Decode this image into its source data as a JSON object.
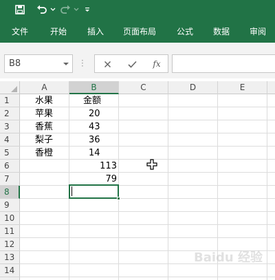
{
  "app": {
    "accent": "#217346"
  },
  "quick_access": {
    "save_icon": "save-icon",
    "undo_icon": "undo-icon",
    "redo_icon": "redo-icon",
    "customize_icon": "customize-quick-access-icon"
  },
  "ribbon": {
    "tabs": [
      "文件",
      "开始",
      "插入",
      "页面布局",
      "公式",
      "数据",
      "审阅"
    ]
  },
  "formula_bar": {
    "name_box": "B8",
    "cancel_icon": "cancel-icon",
    "enter_icon": "check-icon",
    "fx_label": "fx",
    "formula": ""
  },
  "sheet": {
    "columns": [
      "A",
      "B",
      "C",
      "D",
      "E"
    ],
    "rows": [
      "1",
      "2",
      "3",
      "4",
      "5",
      "6",
      "7",
      "8",
      "9",
      "10",
      "11",
      "12",
      "13",
      "14"
    ],
    "selected_cell": "B8",
    "cells": {
      "A1": "水果",
      "B1": "金额",
      "A2": "苹果",
      "B2": "20",
      "A3": "香蕉",
      "B3": "43",
      "A4": "梨子",
      "B4": "36",
      "A5": "香橙",
      "B5": "14",
      "B6": "113",
      "B7": "79"
    }
  },
  "watermark": "Baidu 经验"
}
